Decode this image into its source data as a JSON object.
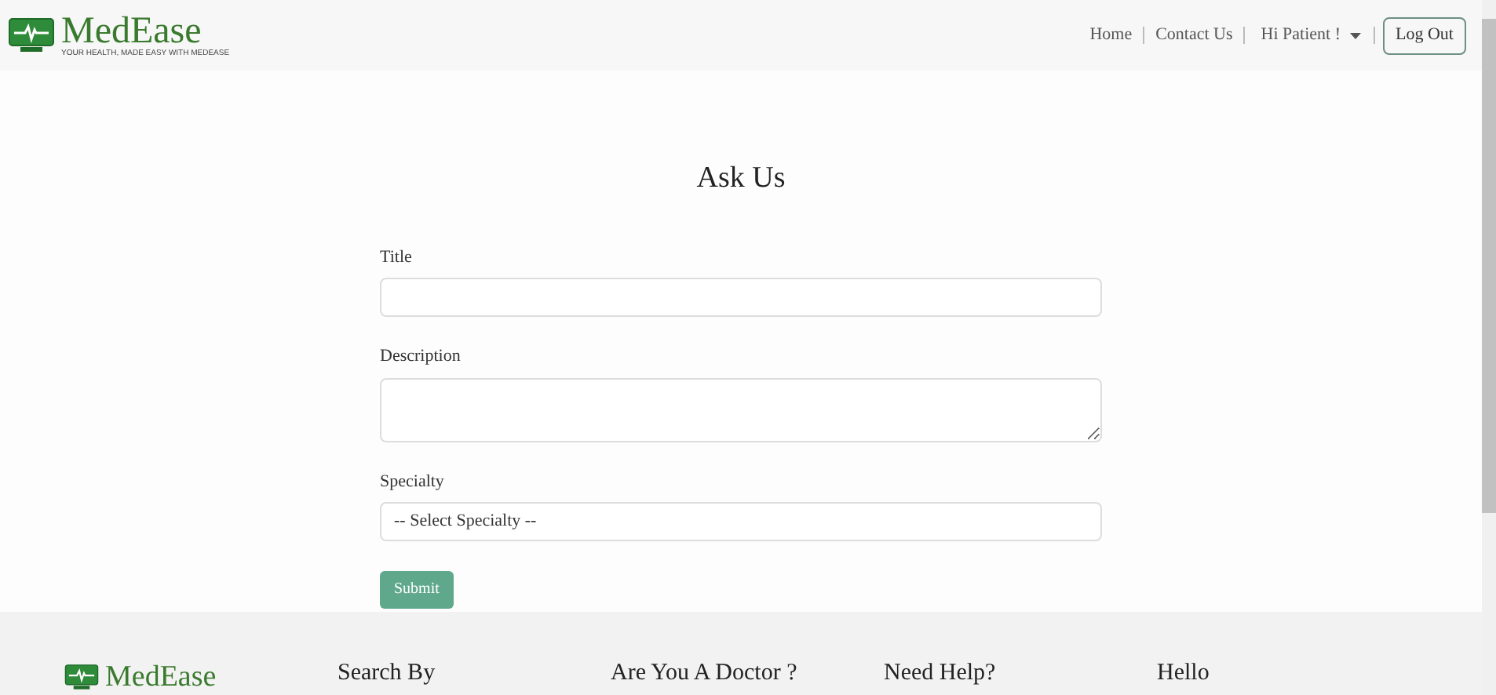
{
  "header": {
    "brand": "MedEase",
    "tagline": "YOUR HEALTH, MADE EASY WITH MEDEASE",
    "nav": [
      "Home",
      "Contact Us"
    ],
    "user_menu": "Hi Patient !",
    "logout": "Log Out"
  },
  "form": {
    "title": "Ask Us",
    "fields": [
      {
        "kind": "input",
        "label": "Title"
      },
      {
        "kind": "textarea",
        "label": "Description"
      },
      {
        "kind": "select",
        "label": "Specialty",
        "value": "-- Select Specialty --"
      }
    ],
    "submit": "Submit"
  },
  "footer": {
    "brand": "MedEase",
    "headings": [
      "Search By",
      "Are You A Doctor ?",
      "Need Help?",
      "Hello"
    ]
  }
}
